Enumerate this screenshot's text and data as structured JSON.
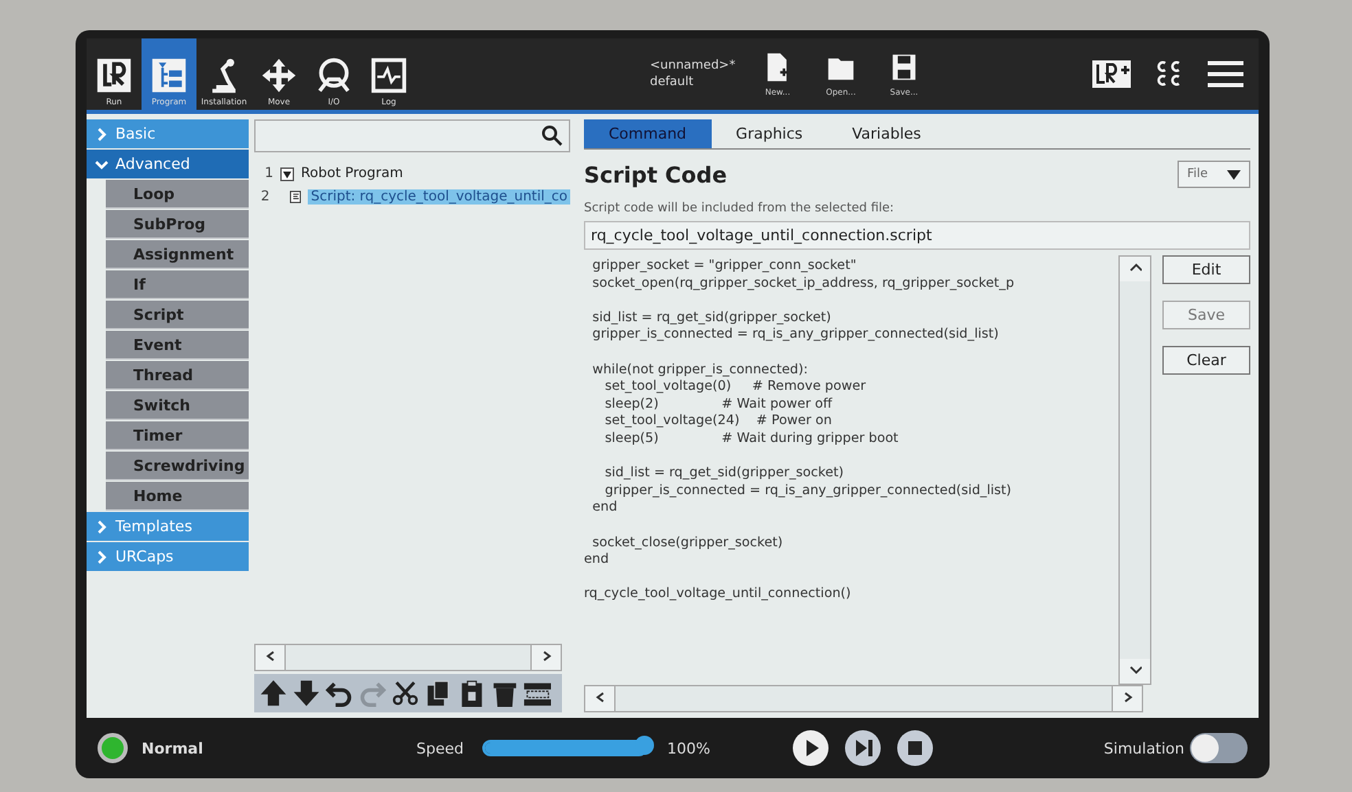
{
  "header": {
    "tabs": [
      {
        "kind": "run",
        "label": "Run",
        "selected": false
      },
      {
        "kind": "program",
        "label": "Program",
        "selected": true
      },
      {
        "kind": "installation",
        "label": "Installation",
        "selected": false
      },
      {
        "kind": "move",
        "label": "Move",
        "selected": false
      },
      {
        "kind": "io",
        "label": "I/O",
        "selected": false
      },
      {
        "kind": "log",
        "label": "Log",
        "selected": false
      }
    ],
    "program_name": "<unnamed>*",
    "installation_name": "default",
    "file_buttons": [
      {
        "kind": "new",
        "label": "New..."
      },
      {
        "kind": "open",
        "label": "Open..."
      },
      {
        "kind": "save",
        "label": "Save..."
      }
    ]
  },
  "sidebar": {
    "groups": [
      {
        "label": "Basic",
        "expanded": false
      },
      {
        "label": "Advanced",
        "expanded": true,
        "children": [
          {
            "label": "Loop"
          },
          {
            "label": "SubProg"
          },
          {
            "label": "Assignment"
          },
          {
            "label": "If"
          },
          {
            "label": "Script"
          },
          {
            "label": "Event"
          },
          {
            "label": "Thread"
          },
          {
            "label": "Switch"
          },
          {
            "label": "Timer"
          },
          {
            "label": "Screwdriving"
          },
          {
            "label": "Home"
          }
        ]
      },
      {
        "label": "Templates",
        "expanded": false
      },
      {
        "label": "URCaps",
        "expanded": false
      }
    ]
  },
  "program_tree": {
    "rows": [
      {
        "number": "1",
        "label": "Robot Program",
        "expanded": true,
        "selected": false,
        "kind": "root"
      },
      {
        "number": "2",
        "label": "Script: rq_cycle_tool_voltage_until_co",
        "selected": true,
        "kind": "script"
      }
    ],
    "toolbar": [
      {
        "kind": "up",
        "disabled": false
      },
      {
        "kind": "down",
        "disabled": false
      },
      {
        "kind": "undo",
        "disabled": false
      },
      {
        "kind": "redo",
        "disabled": true
      },
      {
        "kind": "cut",
        "disabled": false
      },
      {
        "kind": "copy",
        "disabled": false
      },
      {
        "kind": "paste",
        "disabled": false
      },
      {
        "kind": "delete",
        "disabled": false
      },
      {
        "kind": "suppress",
        "disabled": false
      }
    ]
  },
  "details": {
    "tabs": [
      {
        "label": "Command",
        "selected": true
      },
      {
        "label": "Graphics",
        "selected": false
      },
      {
        "label": "Variables",
        "selected": false
      }
    ],
    "title": "Script Code",
    "mode": "File",
    "hint": "Script code will be included from the selected file:",
    "file_name": "rq_cycle_tool_voltage_until_connection.script",
    "code_blocks": [
      [
        "  gripper_socket = \"gripper_conn_socket\"",
        "  socket_open(rq_gripper_socket_ip_address, rq_gripper_socket_p"
      ],
      [
        "  sid_list = rq_get_sid(gripper_socket)",
        "  gripper_is_connected = rq_is_any_gripper_connected(sid_list)"
      ],
      [
        "  while(not gripper_is_connected):",
        "     set_tool_voltage(0)     # Remove power",
        "     sleep(2)               # Wait power off",
        "     set_tool_voltage(24)    # Power on",
        "     sleep(5)               # Wait during gripper boot"
      ],
      [
        "     sid_list = rq_get_sid(gripper_socket)",
        "     gripper_is_connected = rq_is_any_gripper_connected(sid_list)",
        "  end"
      ],
      [
        "  socket_close(gripper_socket)",
        "end"
      ],
      [
        "rq_cycle_tool_voltage_until_connection()"
      ]
    ],
    "buttons": [
      {
        "label": "Edit",
        "disabled": false
      },
      {
        "label": "Save",
        "disabled": true
      },
      {
        "label": "Clear",
        "disabled": false
      }
    ]
  },
  "footer": {
    "status": "Normal",
    "speed_label": "Speed",
    "speed": {
      "level": 1.0
    },
    "speed_reading": "100%",
    "simulation_label": "Simulation",
    "simulation_on": false
  }
}
